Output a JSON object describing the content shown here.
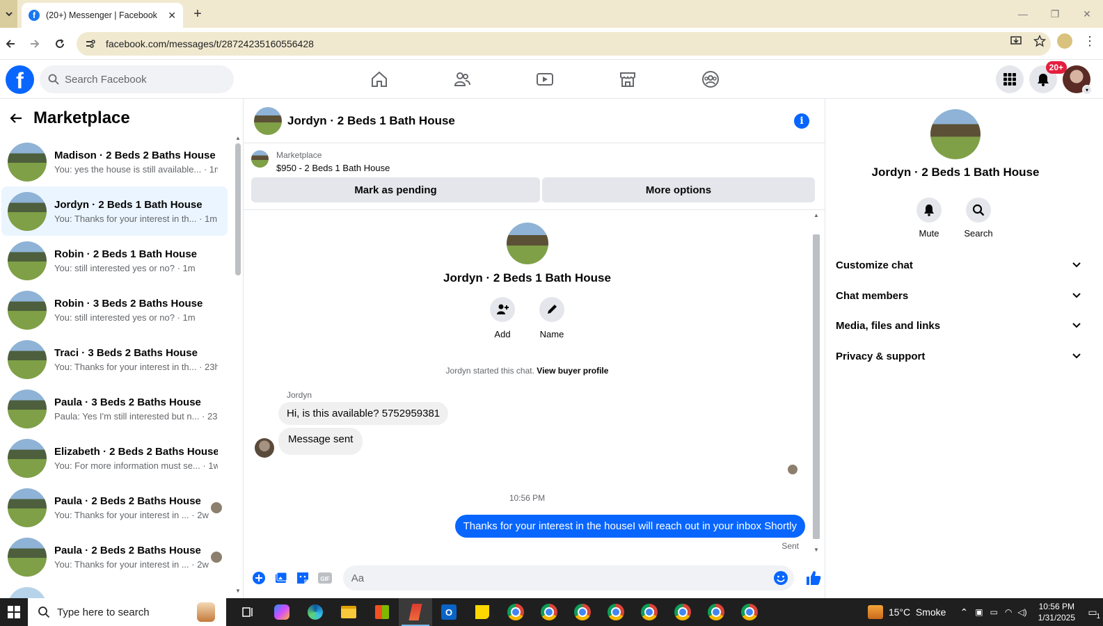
{
  "browser": {
    "tab_title": "(20+) Messenger | Facebook",
    "tab_favicon": "f",
    "url": "facebook.com/messages/t/28724235160556428"
  },
  "fb": {
    "logo": "f",
    "search_placeholder": "Search Facebook",
    "notification_badge": "20+"
  },
  "left": {
    "title": "Marketplace",
    "conversations": [
      {
        "name": "Madison · 2 Beds 2 Baths House",
        "preview": "You: yes the house is still available... · 1m"
      },
      {
        "name": "Jordyn · 2 Beds 1 Bath House",
        "preview": "You: Thanks for your interest in th... · 1m"
      },
      {
        "name": "Robin · 2 Beds 1 Bath House",
        "preview": "You: still interested yes or no? · 1m"
      },
      {
        "name": "Robin · 3 Beds 2 Baths House",
        "preview": "You: still interested yes or no? · 1m"
      },
      {
        "name": "Traci · 3 Beds 2 Baths House",
        "preview": "You: Thanks for your interest in th... · 23h"
      },
      {
        "name": "Paula · 3 Beds 2 Baths House",
        "preview": "Paula: Yes I'm still interested but n... · 23h"
      },
      {
        "name": "Elizabeth · 2 Beds 2 Baths House",
        "preview": "You: For more information must se... · 1w"
      },
      {
        "name": "Paula · 2 Beds 2 Baths House",
        "preview": "You: Thanks for your interest in ... · 2w"
      },
      {
        "name": "Paula · 2 Beds 2 Baths House",
        "preview": "You: Thanks for your interest in ... · 2w"
      }
    ]
  },
  "chat": {
    "title": "Jordyn · 2 Beds 1 Bath House",
    "listing_source": "Marketplace",
    "listing_title": "$950 - 2 Beds 1 Bath House",
    "mark_pending": "Mark as pending",
    "more_options": "More options",
    "intro_name": "Jordyn · 2 Beds 1 Bath House",
    "add_label": "Add",
    "name_label": "Name",
    "started_text": "Jordyn started this chat. ",
    "view_profile": "View buyer profile",
    "sender": "Jordyn",
    "msg1": "Hi, is this available? 5752959381",
    "msg2": "Message sent",
    "timestamp": "10:56 PM",
    "msg_out": "Thanks for your interest in the houseI will reach out in your inbox Shortly",
    "sent_label": "Sent",
    "composer_placeholder": "Aa"
  },
  "right": {
    "name": "Jordyn · 2 Beds 1 Bath House",
    "mute": "Mute",
    "search": "Search",
    "sections": [
      "Customize chat",
      "Chat members",
      "Media, files and links",
      "Privacy & support"
    ]
  },
  "taskbar": {
    "search_placeholder": "Type here to search",
    "weather": "15°C  Smoke",
    "time": "10:56 PM",
    "date": "1/31/2025",
    "notif_count": "1"
  },
  "colors": {
    "fb_blue": "#0866ff",
    "tab_bg": "#f1e9cf",
    "active_conv": "#ebf5ff"
  }
}
